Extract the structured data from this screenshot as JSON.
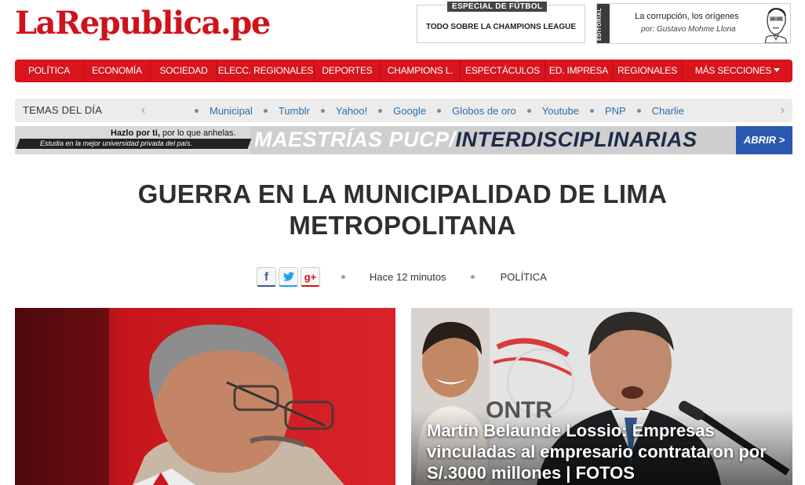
{
  "logo": {
    "text": "LaRepublica.pe"
  },
  "promo_football": {
    "tag": "ESPECIAL DE FÚTBOL",
    "text": "TODO SOBRE LA CHAMPIONS LEAGUE"
  },
  "promo_editorial": {
    "tag": "EDITORIAL",
    "title": "La corrupción, los orígenes",
    "byline": "por: Gustavo Mohme Llona"
  },
  "nav": {
    "items": [
      "POLÍTICA",
      "ECONOMÍA",
      "SOCIEDAD",
      "ELECC. REGIONALES",
      "DEPORTES",
      "CHAMPIONS L.",
      "ESPECTÁCULOS",
      "ED. IMPRESA",
      "REGIONALES",
      "MÁS SECCIONES"
    ]
  },
  "topics": {
    "title": "TEMAS DEL DÍA",
    "items": [
      "Municipal",
      "Tumblr",
      "Yahoo!",
      "Google",
      "Globos de oro",
      "Youtube",
      "PNP",
      "Charlie"
    ]
  },
  "ad": {
    "line1_bold": "Hazlo por ti,",
    "line1_rest": " por lo que anhelas.",
    "line2": "Estudia en la mejor universidad privada del país.",
    "headline_a": "MAESTRÍAS PUCP/",
    "headline_b": "INTERDISCIPLINARIAS",
    "button": "ABRIR >"
  },
  "article": {
    "title_line1": "GUERRA EN LA MUNICIPALIDAD DE LIMA",
    "title_line2": "METROPOLITANA",
    "time": "Hace 12 minutos",
    "section": "POLÍTICA",
    "share": {
      "facebook": "f",
      "twitter": "t",
      "gplus": "g+"
    }
  },
  "related": {
    "caption": "Martín Belaunde Lossio: Empresas vinculadas al empresario contrataron por S/.3000 millones | FOTOS"
  },
  "colors": {
    "brand_red": "#d8141c",
    "link_blue": "#2e6ca8",
    "ad_blue": "#2c59b0"
  }
}
